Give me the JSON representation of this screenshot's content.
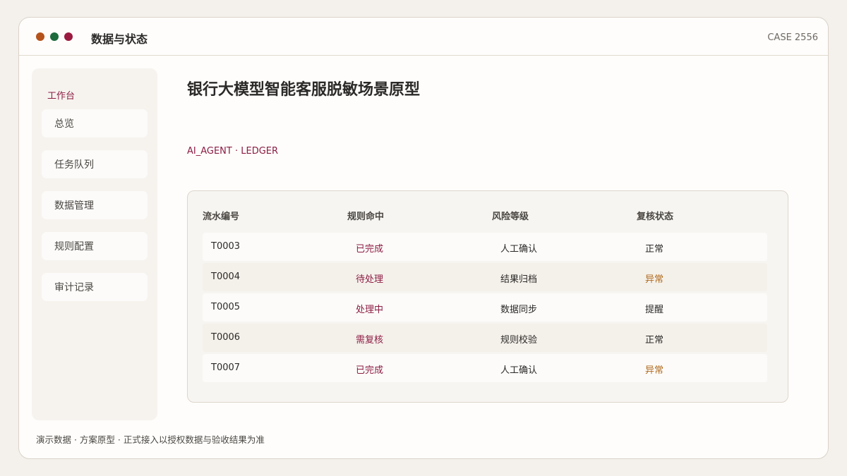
{
  "titlebar": {
    "title": "数据与状态",
    "case_id": "CASE 2556",
    "dot_colors": [
      "#b5531c",
      "#1d6a3d",
      "#9a1b3f"
    ]
  },
  "sidebar": {
    "heading": "工作台",
    "items": [
      {
        "label": "总览",
        "active": false
      },
      {
        "label": "任务队列",
        "active": true
      },
      {
        "label": "数据管理",
        "active": false
      },
      {
        "label": "规则配置",
        "active": false
      },
      {
        "label": "审计记录",
        "active": false
      }
    ]
  },
  "main": {
    "title": "银行大模型智能客服脱敏场景原型",
    "subtitle": "AI_AGENT · LEDGER"
  },
  "table": {
    "columns": [
      "流水编号",
      "规则命中",
      "风险等级",
      "复核状态"
    ],
    "rows": [
      {
        "id": "T0003",
        "rule": "已完成",
        "risk": "人工确认",
        "status": "正常",
        "status_type": "normal"
      },
      {
        "id": "T0004",
        "rule": "待处理",
        "risk": "结果归档",
        "status": "异常",
        "status_type": "warn"
      },
      {
        "id": "T0005",
        "rule": "处理中",
        "risk": "数据同步",
        "status": "提醒",
        "status_type": "normal"
      },
      {
        "id": "T0006",
        "rule": "需复核",
        "risk": "规则校验",
        "status": "正常",
        "status_type": "normal"
      },
      {
        "id": "T0007",
        "rule": "已完成",
        "risk": "人工确认",
        "status": "异常",
        "status_type": "warn"
      }
    ]
  },
  "colors": {
    "accent": "#8c1d44",
    "warn": "#b06a1e",
    "text": "#2b2a28"
  },
  "footer": {
    "text": "演示数据 · 方案原型 · 正式接入以授权数据与验收结果为准"
  }
}
